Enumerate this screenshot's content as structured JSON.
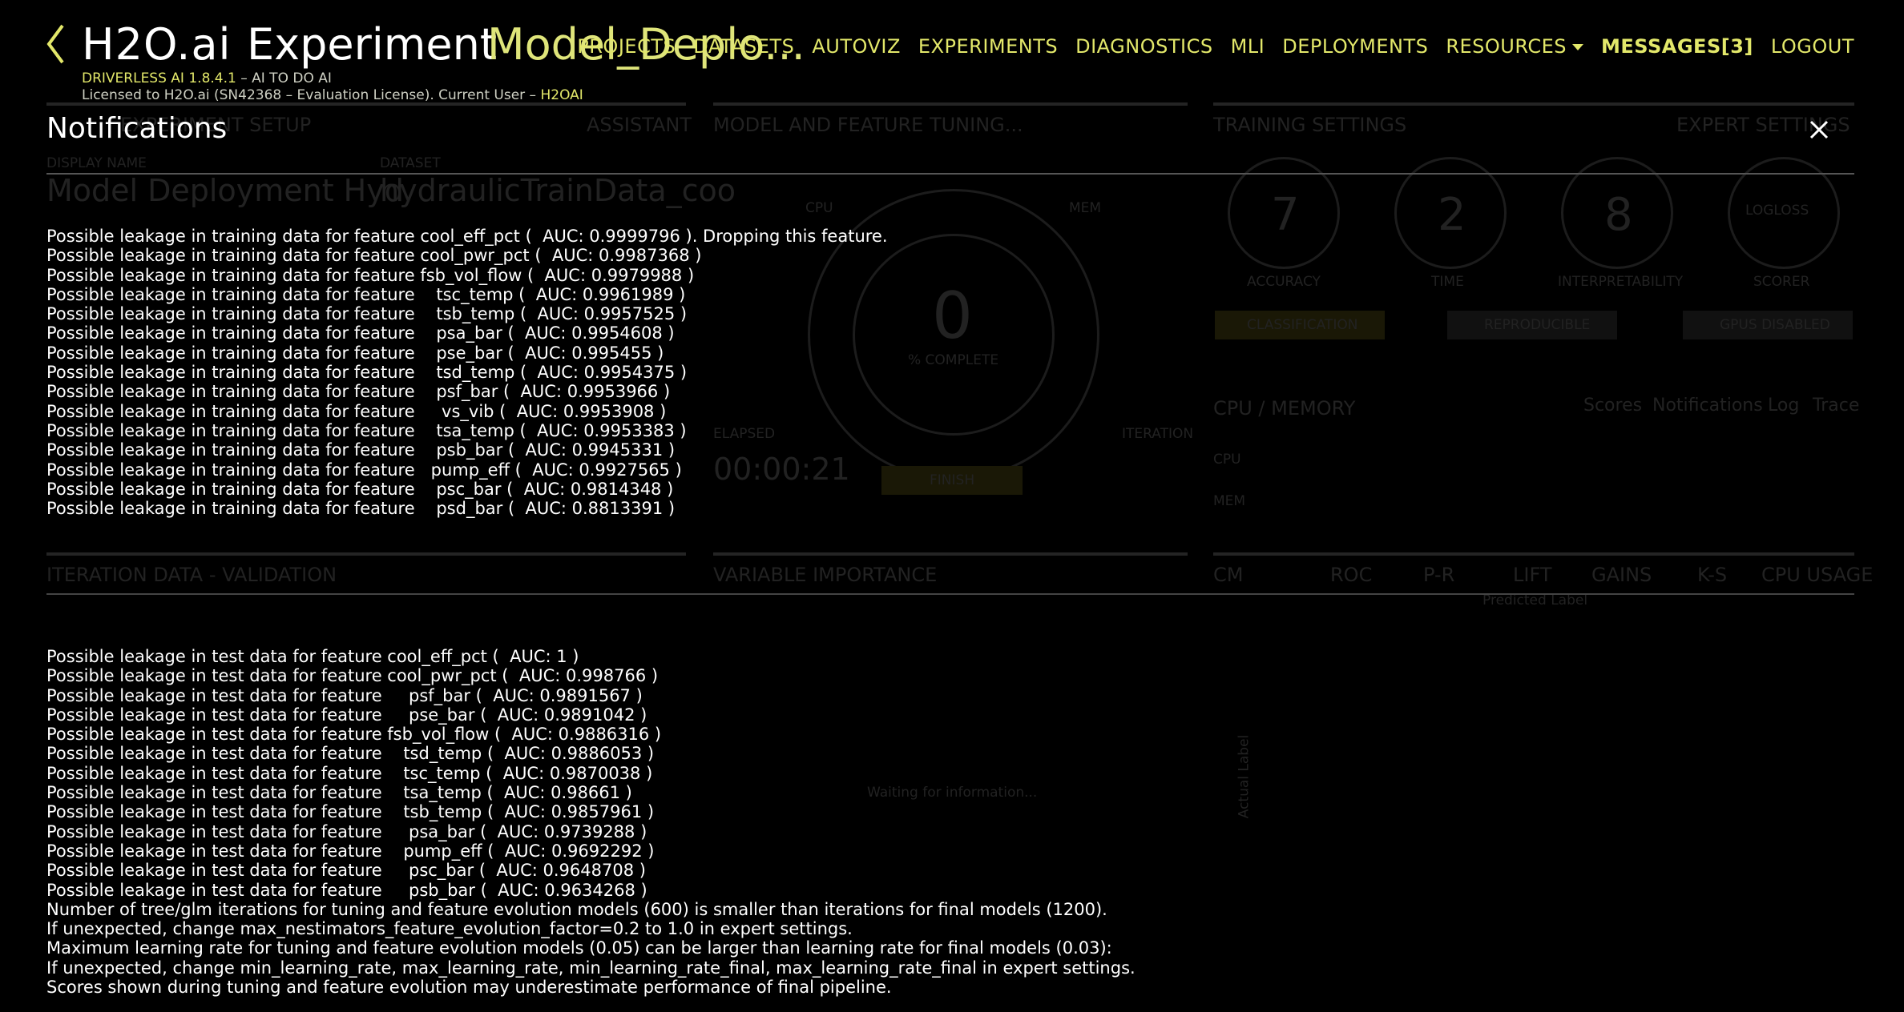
{
  "header": {
    "brand": "H2O.ai",
    "experiment_word": "Experiment",
    "experiment_name": "Model_Deplo...",
    "version_label": "DRIVERLESS AI 1.8.4.1",
    "version_tagline": " – AI TO DO AI",
    "license_text": "Licensed to H2O.ai (SN42368 – Evaluation License). Current User – ",
    "current_user": "H2OAI"
  },
  "nav": {
    "projects": "PROJECTS",
    "datasets": "DATASETS",
    "autoviz": "AUTOVIZ",
    "experiments": "EXPERIMENTS",
    "diagnostics": "DIAGNOSTICS",
    "mli": "MLI",
    "deployments": "DEPLOYMENTS",
    "resources": "RESOURCES",
    "messages": "MESSAGES[3]",
    "logout": "LOGOUT"
  },
  "background": {
    "setup_title": "EXPERIMENT SETUP",
    "assistant": "ASSISTANT",
    "display_name_label": "DISPLAY NAME",
    "display_name_value": "Model Deployment Hyd",
    "dataset_label": "DATASET",
    "dataset_value": "hydraulicTrainData_coo",
    "tuning_title": "MODEL AND FEATURE TUNING...",
    "cpu": "CPU",
    "mem": "MEM",
    "gauge_value": "0",
    "gauge_label": "% COMPLETE",
    "elapsed_label": "ELAPSED",
    "elapsed_value": "00:00:21",
    "iteration_label": "ITERATION",
    "finish": "FINISH",
    "training_settings": "TRAINING SETTINGS",
    "expert_settings": "EXPERT SETTINGS",
    "accuracy_value": "7",
    "accuracy_label": "ACCURACY",
    "time_value": "2",
    "time_label": "TIME",
    "interp_value": "8",
    "interp_label": "INTERPRETABILITY",
    "scorer_value": "LOGLOSS",
    "scorer_label": "SCORER",
    "classification": "CLASSIFICATION",
    "reproducible": "REPRODUCIBLE",
    "gpus": "GPUS DISABLED",
    "cpu_memory": "CPU / MEMORY",
    "tab_scores": "Scores",
    "tab_notifications": "Notifications",
    "tab_log": "Log",
    "tab_trace": "Trace",
    "cpu_row": "CPU",
    "mem_row": "MEM",
    "iter_data": "ITERATION DATA - VALIDATION",
    "var_importance": "VARIABLE IMPORTANCE",
    "cm": "CM",
    "roc": "ROC",
    "pr": "P-R",
    "lift": "LIFT",
    "gains": "GAINS",
    "ks": "K-S",
    "cpu_usage": "CPU USAGE",
    "predicted_label": "Predicted Label",
    "actual_label": "Actual Label",
    "waiting": "Waiting for information..."
  },
  "notifications": {
    "title": "Notifications",
    "training_messages": [
      "Possible leakage in training data for feature cool_eff_pct (  AUC: 0.9999796 ). Dropping this feature.",
      "Possible leakage in training data for feature cool_pwr_pct (  AUC: 0.9987368 )",
      "Possible leakage in training data for feature fsb_vol_flow (  AUC: 0.9979988 )",
      "Possible leakage in training data for feature    tsc_temp (  AUC: 0.9961989 )",
      "Possible leakage in training data for feature    tsb_temp (  AUC: 0.9957525 )",
      "Possible leakage in training data for feature    psa_bar (  AUC: 0.9954608 )",
      "Possible leakage in training data for feature    pse_bar (  AUC: 0.995455 )",
      "Possible leakage in training data for feature    tsd_temp (  AUC: 0.9954375 )",
      "Possible leakage in training data for feature    psf_bar (  AUC: 0.9953966 )",
      "Possible leakage in training data for feature     vs_vib (  AUC: 0.9953908 )",
      "Possible leakage in training data for feature    tsa_temp (  AUC: 0.9953383 )",
      "Possible leakage in training data for feature    psb_bar (  AUC: 0.9945331 )",
      "Possible leakage in training data for feature   pump_eff (  AUC: 0.9927565 )",
      "Possible leakage in training data for feature    psc_bar (  AUC: 0.9814348 )",
      "Possible leakage in training data for feature    psd_bar (  AUC: 0.8813391 )"
    ],
    "test_messages": [
      "Possible leakage in test data for feature cool_eff_pct (  AUC: 1 )",
      "Possible leakage in test data for feature cool_pwr_pct (  AUC: 0.998766 )",
      "Possible leakage in test data for feature     psf_bar (  AUC: 0.9891567 )",
      "Possible leakage in test data for feature     pse_bar (  AUC: 0.9891042 )",
      "Possible leakage in test data for feature fsb_vol_flow (  AUC: 0.9886316 )",
      "Possible leakage in test data for feature    tsd_temp (  AUC: 0.9886053 )",
      "Possible leakage in test data for feature    tsc_temp (  AUC: 0.9870038 )",
      "Possible leakage in test data for feature    tsa_temp (  AUC: 0.98661 )",
      "Possible leakage in test data for feature    tsb_temp (  AUC: 0.9857961 )",
      "Possible leakage in test data for feature     psa_bar (  AUC: 0.9739288 )",
      "Possible leakage in test data for feature    pump_eff (  AUC: 0.9692292 )",
      "Possible leakage in test data for feature     psc_bar (  AUC: 0.9648708 )",
      "Possible leakage in test data for feature     psb_bar (  AUC: 0.9634268 )",
      "Number of tree/glm iterations for tuning and feature evolution models (600) is smaller than iterations for final models (1200).",
      "If unexpected, change max_nestimators_feature_evolution_factor=0.2 to 1.0 in expert settings.",
      "Maximum learning rate for tuning and feature evolution models (0.05) can be larger than learning rate for final models (0.03):",
      "If unexpected, change min_learning_rate, max_learning_rate, min_learning_rate_final, max_learning_rate_final in expert settings.",
      "Scores shown during tuning and feature evolution may underestimate performance of final pipeline."
    ]
  },
  "colors": {
    "accent": "#e3e86a",
    "background": "#000000",
    "text": "#ffffff"
  },
  "icons": {
    "back": "chevron-left-icon",
    "close": "close-icon",
    "dropdown": "caret-down-icon"
  }
}
